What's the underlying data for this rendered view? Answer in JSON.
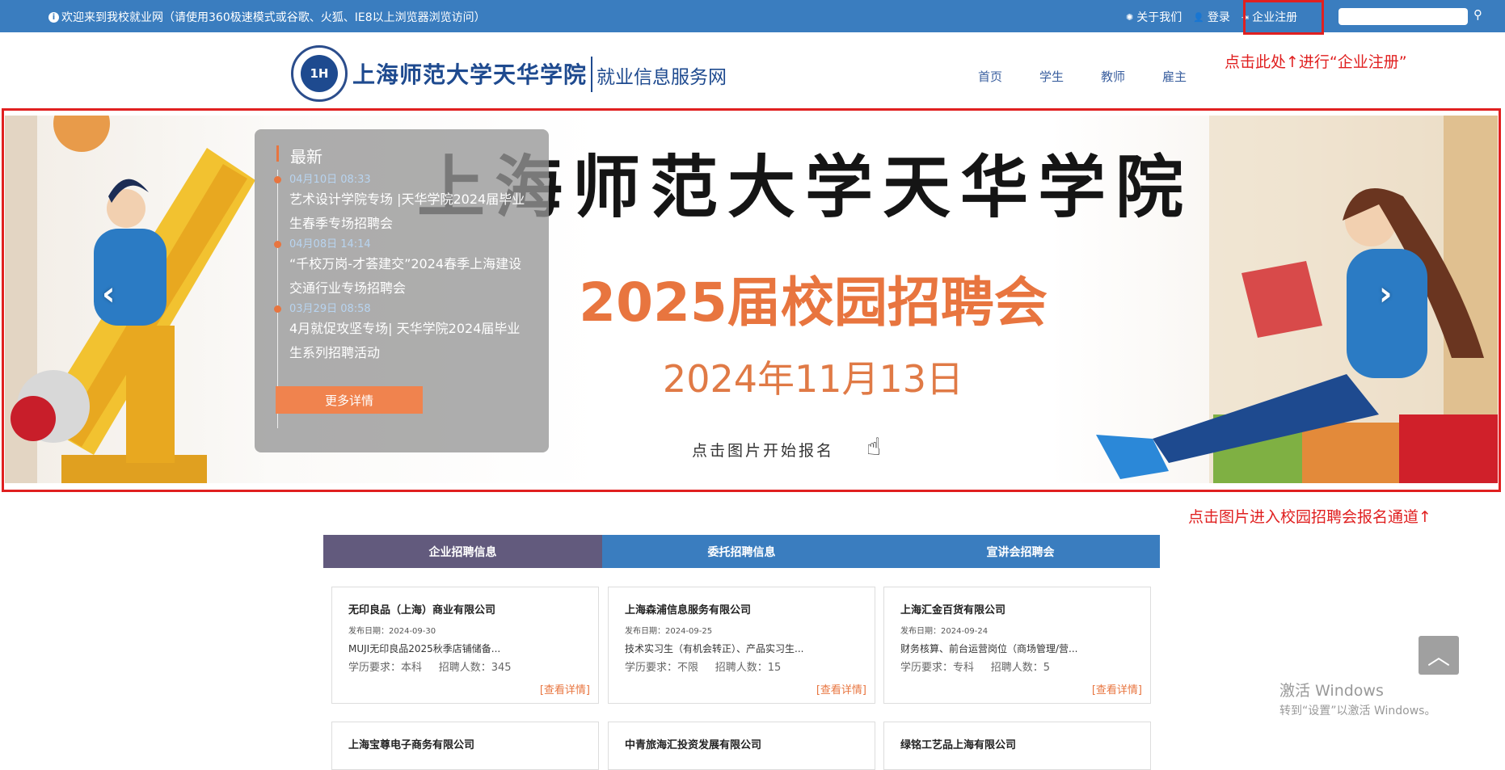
{
  "topbar": {
    "welcome": "欢迎来到我校就业网（请使用360极速模式或谷歌、火狐、IE8以上浏览器浏览访问）",
    "about": "关于我们",
    "login": "登录",
    "register": "企业注册",
    "search_placeholder": ""
  },
  "header": {
    "logo_text": "1H",
    "school_name": "上海师范大学天华学院",
    "site_name": "就业信息服务网",
    "nav": [
      "首页",
      "学生",
      "教师",
      "雇主"
    ]
  },
  "notes": {
    "register_hint": "点击此处↑进行“企业注册”",
    "banner_hint": "点击图片进入校园招聘会报名通道↑"
  },
  "banner": {
    "title": "上海师范大学天华学院",
    "subtitle": "2025届校园招聘会",
    "date": "2024年11月13日",
    "cta": "点击图片开始报名",
    "prev": "‹",
    "next": "›"
  },
  "latest": {
    "heading": "最新",
    "items": [
      {
        "time": "04月10日 08:33",
        "title": "艺术设计学院专场 |天华学院2024届毕业生春季专场招聘会"
      },
      {
        "time": "04月08日 14:14",
        "title": "“千校万岗-才荟建交”2024春季上海建设交通行业专场招聘会"
      },
      {
        "time": "03月29日 08:58",
        "title": "4月就促攻坚专场| 天华学院2024届毕业生系列招聘活动"
      }
    ],
    "more": "更多详情"
  },
  "tabs": [
    "企业招聘信息",
    "委托招聘信息",
    "宣讲会招聘会"
  ],
  "cards": [
    {
      "company": "无印良品（上海）商业有限公司",
      "date": "发布日期：2024-09-30",
      "job": "MUJI无印良品2025秋季店铺储备...",
      "edu": "学历要求：本科",
      "count": "招聘人数：345",
      "more": "[查看详情]"
    },
    {
      "company": "上海森浦信息服务有限公司",
      "date": "发布日期：2024-09-25",
      "job": "技术实习生（有机会转正）、产品实习生...",
      "edu": "学历要求：不限",
      "count": "招聘人数：15",
      "more": "[查看详情]"
    },
    {
      "company": "上海汇金百货有限公司",
      "date": "发布日期：2024-09-24",
      "job": "财务核算、前台运营岗位（商场管理/营...",
      "edu": "学历要求：专科",
      "count": "招聘人数：5",
      "more": "[查看详情]"
    },
    {
      "company": "上海宝尊电子商务有限公司"
    },
    {
      "company": "中青旅海汇投资发展有限公司"
    },
    {
      "company": "绿铭工艺品上海有限公司"
    }
  ],
  "to_top": "︿",
  "windows": {
    "line1": "激活 Windows",
    "line2": "转到“设置”以激活 Windows。"
  },
  "colors": {
    "topbar": "#3a7dbf",
    "accent": "#e8753f",
    "annotation": "#e02020",
    "tab_active": "#625a7d"
  }
}
